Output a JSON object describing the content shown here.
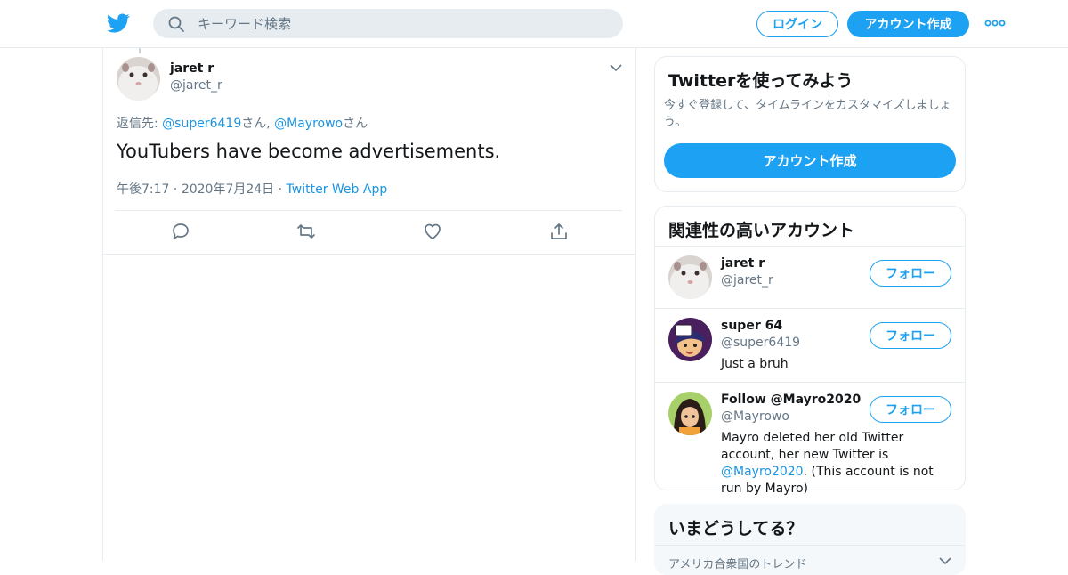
{
  "header": {
    "logo_icon": "twitter-bird-icon",
    "search_placeholder": "キーワード検索",
    "login_label": "ログイン",
    "signup_label": "アカウント作成",
    "more_icon": "more-dots-icon",
    "brand_color": "#1da1f2"
  },
  "tweet": {
    "name": "jaret r",
    "handle": "@jaret_r",
    "reply_prefix": "返信先: ",
    "reply_user1": "@super6419",
    "reply_suffix1": "さん, ",
    "reply_user2": "@Mayrowo",
    "reply_suffix2": "さん",
    "text": "YouTubers have become advertisements.",
    "time": "午後7:17",
    "date": "2020年7月24日",
    "source": "Twitter Web App",
    "actions": [
      "reply-icon",
      "retweet-icon",
      "like-icon",
      "share-icon"
    ]
  },
  "try_card": {
    "title": "Twitterを使ってみよう",
    "description": "今すぐ登録して、タイムラインをカスタマイズしましょう。",
    "button": "アカウント作成"
  },
  "related": {
    "title": "関連性の高いアカウント",
    "follow_label": "フォロー",
    "accounts": [
      {
        "name": "jaret r",
        "handle": "@jaret_r",
        "bio": ""
      },
      {
        "name": "super 64",
        "handle": "@super6419",
        "bio": "Just a bruh"
      },
      {
        "name": "Follow @Mayro2020",
        "handle": "@Mayrowo",
        "bio_before": "Mayro deleted her old Twitter account, her new Twitter is ",
        "bio_link": "@Mayro2020",
        "bio_after": ". (This account is not run by Mayro)"
      }
    ]
  },
  "trends": {
    "title": "いまどうしてる？",
    "subtitle": "アメリカ合衆国のトレンド"
  }
}
